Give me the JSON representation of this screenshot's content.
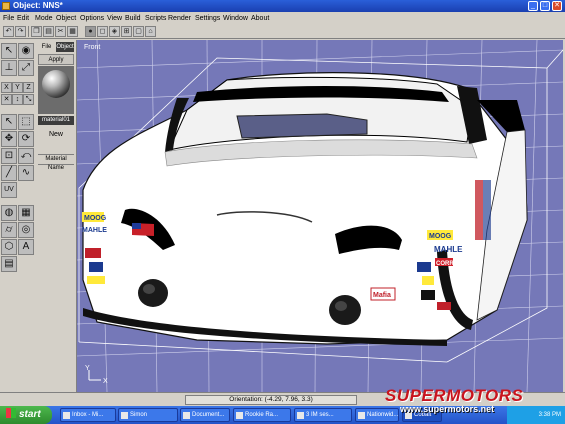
{
  "window": {
    "title": "Object: NNS*"
  },
  "menu": [
    "File",
    "Edit",
    "Mode",
    "Object",
    "Options",
    "View",
    "Build",
    "Scripts",
    "Render",
    "Settings",
    "Window",
    "About"
  ],
  "toolbar_icons": [
    "undo-icon",
    "redo-icon",
    "copy-icon",
    "paste-icon",
    "cut-icon",
    "grid-icon",
    "sphere-icon",
    "cube-icon",
    "object-icon",
    "view-quad-icon",
    "view-single-icon",
    "lock-icon"
  ],
  "panel": {
    "tab_file": "File",
    "tab_object": "Object",
    "apply": "Apply",
    "material_slot": "material01",
    "new": "New",
    "material_name_label": "Material Name"
  },
  "viewport": {
    "label": "Front",
    "axis_y": "Y",
    "axis_x": "X"
  },
  "status": {
    "orientation": "Orientation: (-4.29, 7.96, 3.3)"
  },
  "taskbar": {
    "start": "start",
    "tasks": [
      "Inbox - Mi...",
      "Simon",
      "Document...",
      "Rookie Ra...",
      "3 IM ses...",
      "Nationwid...",
      "Cobalt"
    ],
    "clock": "3:38 PM"
  },
  "watermark": {
    "logo": "SUPERMOTORS",
    "url": "www.supermotors.net"
  },
  "car_decals": [
    "MOOG",
    "MAHLE",
    "MOOG",
    "MAHLE",
    "CORR",
    "Mafia"
  ],
  "colors": {
    "viewport_bg": "#7578b8",
    "grid": "#ffffff",
    "car_body": "#ffffff",
    "taskbar": "#2453c9",
    "watermark": "#c8141e"
  }
}
